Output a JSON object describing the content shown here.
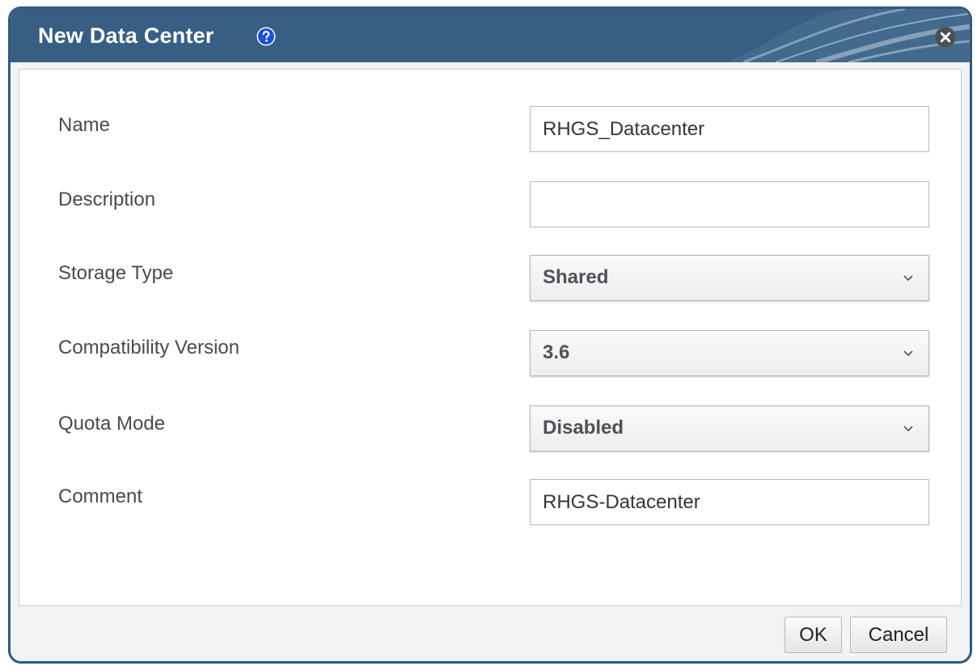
{
  "dialog": {
    "title": "New Data Center",
    "help_icon": "help-question-icon",
    "close_icon": "close-circle-icon",
    "colors": {
      "header": "#365f83",
      "border": "#33597d",
      "help_badge": "#1a4fd6"
    }
  },
  "form": {
    "name": {
      "label": "Name",
      "value": "RHGS_Datacenter"
    },
    "description": {
      "label": "Description",
      "value": ""
    },
    "storage_type": {
      "label": "Storage Type",
      "selected": "Shared"
    },
    "compatibility_version": {
      "label": "Compatibility Version",
      "selected": "3.6"
    },
    "quota_mode": {
      "label": "Quota Mode",
      "selected": "Disabled"
    },
    "comment": {
      "label": "Comment",
      "value": "RHGS-Datacenter"
    }
  },
  "footer": {
    "ok_label": "OK",
    "cancel_label": "Cancel"
  }
}
